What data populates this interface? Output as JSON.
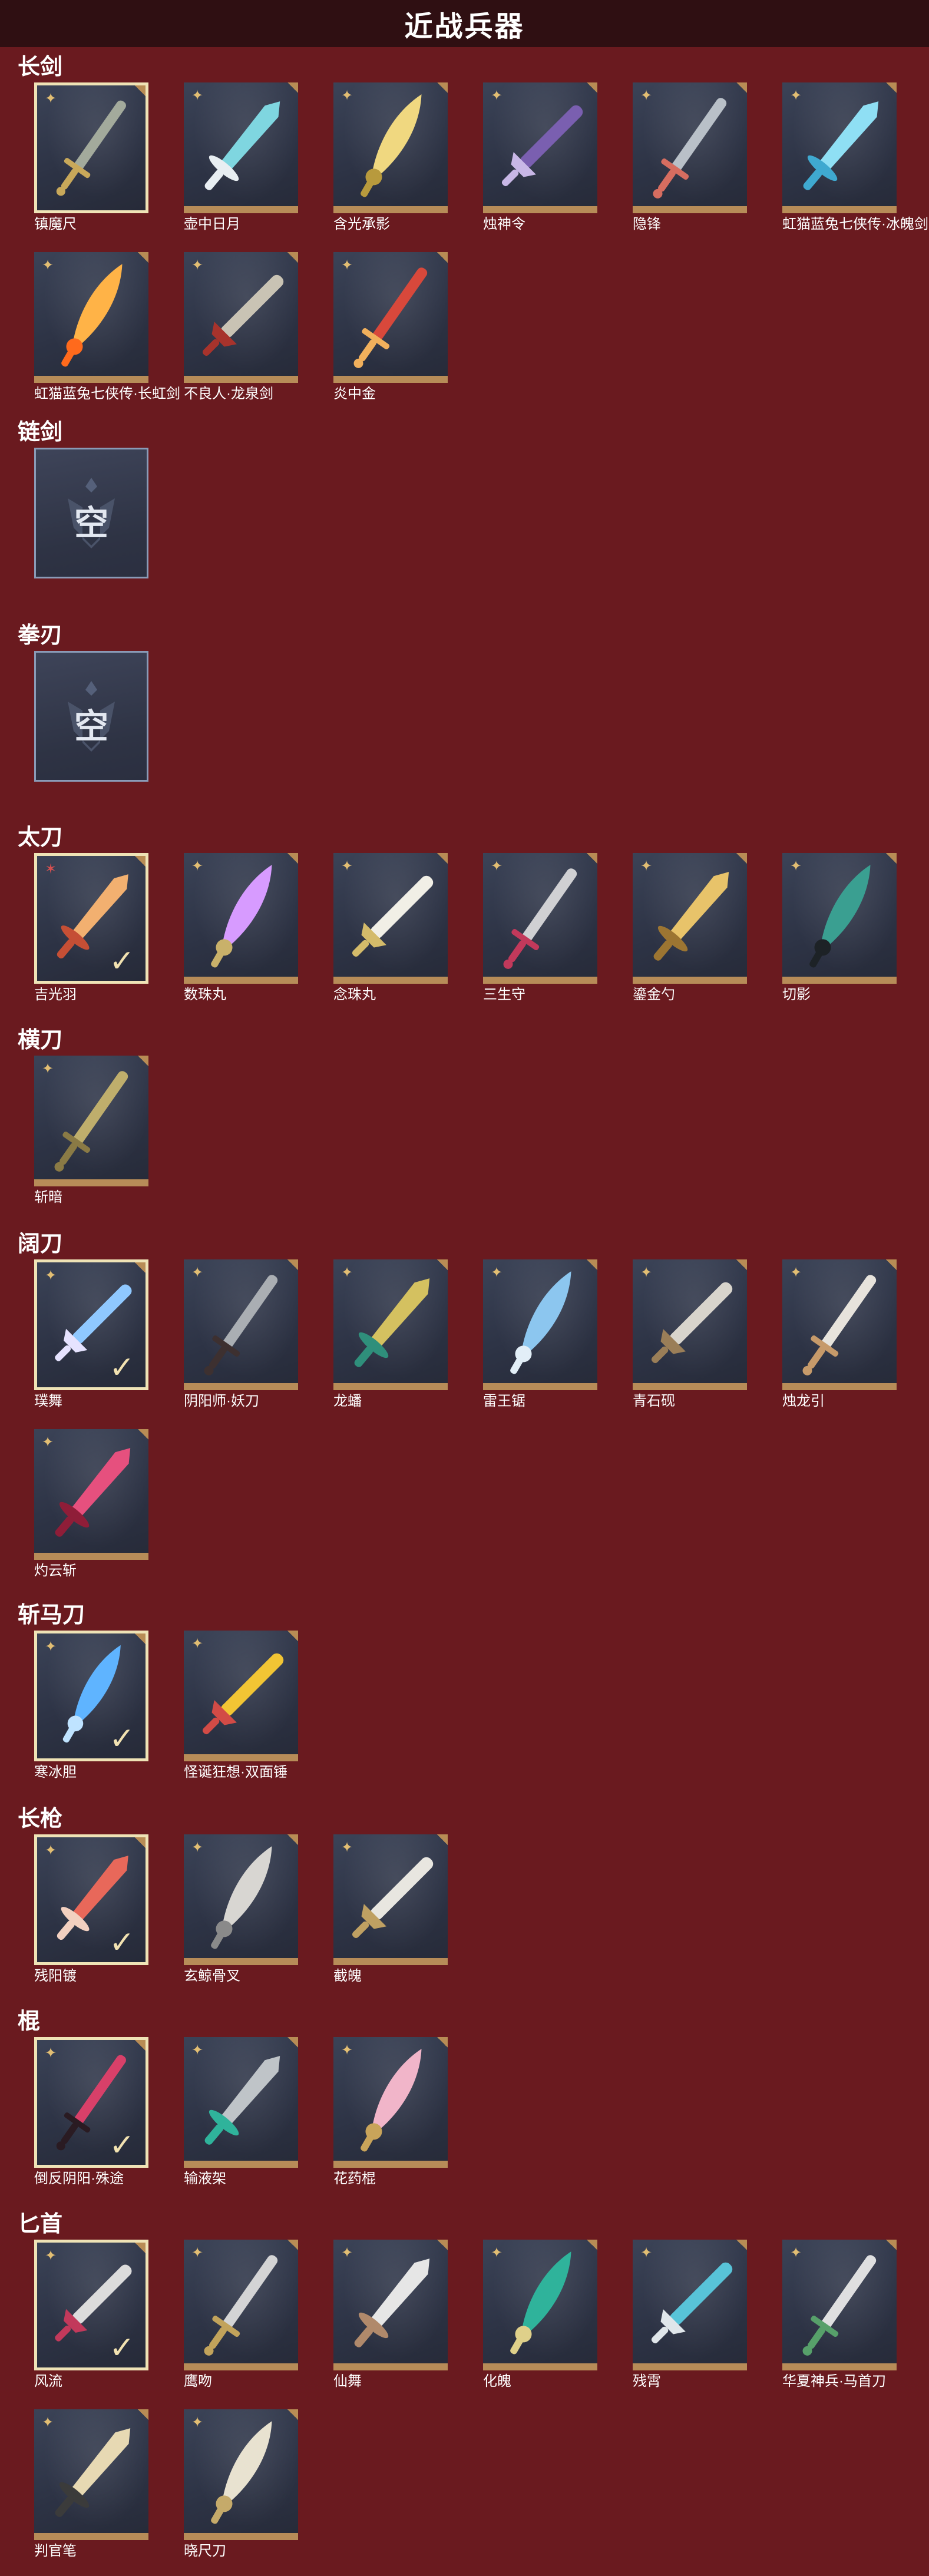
{
  "header": {
    "title": "近战兵器"
  },
  "sections": [
    {
      "label": "长剑",
      "items": [
        {
          "name": "镇魔尺",
          "colors": [
            "#a9b0a0",
            "#c8a85a"
          ],
          "badge": "gold",
          "selected": true
        },
        {
          "name": "壶中日月",
          "colors": [
            "#7fd6e0",
            "#e8eef2"
          ],
          "badge": "gold"
        },
        {
          "name": "含光承影",
          "colors": [
            "#f0d880",
            "#b89a3d"
          ],
          "badge": "gold"
        },
        {
          "name": "烛神令",
          "colors": [
            "#7a5fb0",
            "#c8b7e6"
          ],
          "badge": "gold"
        },
        {
          "name": "隐锋",
          "colors": [
            "#c0c7cf",
            "#d66d60"
          ],
          "badge": "gold"
        },
        {
          "name": "虹猫蓝兔七侠传·冰魄剑",
          "colors": [
            "#8fdff4",
            "#3fa9d0"
          ],
          "badge": "gold"
        },
        {
          "name": "虹猫蓝兔七侠传·长虹剑",
          "colors": [
            "#ffb347",
            "#ff6a1c"
          ],
          "badge": "gold"
        },
        {
          "name": "不良人·龙泉剑",
          "colors": [
            "#c9c3b4",
            "#a7332c"
          ],
          "badge": "gold"
        },
        {
          "name": "炎中金",
          "colors": [
            "#e0493a",
            "#f1b05c"
          ],
          "badge": "gold"
        }
      ]
    },
    {
      "label": "链剑",
      "empty": true,
      "empty_text": "空"
    },
    {
      "label": "拳刃",
      "empty": true,
      "empty_text": "空"
    },
    {
      "label": "太刀",
      "items": [
        {
          "name": "吉光羽",
          "colors": [
            "#f2b070",
            "#c54f35"
          ],
          "badge": "red",
          "selected": true,
          "checked": true
        },
        {
          "name": "数珠丸",
          "colors": [
            "#d79bff",
            "#c9b16a"
          ],
          "badge": "gold"
        },
        {
          "name": "念珠丸",
          "colors": [
            "#f1efe6",
            "#d4bb6a"
          ],
          "badge": "gold"
        },
        {
          "name": "三生守",
          "colors": [
            "#d8d8da",
            "#c2395b"
          ],
          "badge": "gold"
        },
        {
          "name": "鎏金勺",
          "colors": [
            "#e8c36a",
            "#9c7532"
          ],
          "badge": "gold"
        },
        {
          "name": "切影",
          "colors": [
            "#3a9f91",
            "#1d2226"
          ],
          "badge": "gold"
        }
      ]
    },
    {
      "label": "横刀",
      "items": [
        {
          "name": "斩暗",
          "colors": [
            "#c6b46e",
            "#8a7a45"
          ],
          "badge": "gold"
        }
      ]
    },
    {
      "label": "阔刀",
      "items": [
        {
          "name": "璞舞",
          "colors": [
            "#8fc8ff",
            "#e6e3ff"
          ],
          "badge": "gold",
          "selected": true,
          "checked": true
        },
        {
          "name": "阴阳师·妖刀",
          "colors": [
            "#b0b4b8",
            "#3d3030"
          ],
          "badge": "gold"
        },
        {
          "name": "龙蟠",
          "colors": [
            "#d4c160",
            "#2f8f7b"
          ],
          "badge": "gold"
        },
        {
          "name": "雷王锯",
          "colors": [
            "#8cc6ef",
            "#e2eef7"
          ],
          "badge": "gold"
        },
        {
          "name": "青石砚",
          "colors": [
            "#d8d4cc",
            "#9a7e58"
          ],
          "badge": "gold"
        },
        {
          "name": "烛龙引",
          "colors": [
            "#f0ece4",
            "#c69a6a"
          ],
          "badge": "gold"
        },
        {
          "name": "灼云斩",
          "colors": [
            "#e6507e",
            "#8f1d38"
          ],
          "badge": "gold"
        }
      ]
    },
    {
      "label": "斩马刀",
      "items": [
        {
          "name": "寒冰胆",
          "colors": [
            "#5fb4ff",
            "#bfe3ff"
          ],
          "badge": "gold",
          "selected": true,
          "checked": true
        },
        {
          "name": "怪诞狂想·双面锤",
          "colors": [
            "#f2c534",
            "#d24b46"
          ],
          "badge": "gold"
        }
      ]
    },
    {
      "label": "长枪",
      "items": [
        {
          "name": "残阳镀",
          "colors": [
            "#e8685a",
            "#f2d0c0"
          ],
          "badge": "gold",
          "selected": true,
          "checked": true
        },
        {
          "name": "玄鲸骨叉",
          "colors": [
            "#d8d6d2",
            "#8a8a8a"
          ],
          "badge": "gold"
        },
        {
          "name": "截魄",
          "colors": [
            "#e8e6e0",
            "#bfa062"
          ],
          "badge": "gold"
        }
      ]
    },
    {
      "label": "棍",
      "items": [
        {
          "name": "倒反阴阳·殊途",
          "colors": [
            "#e0406a",
            "#2a1b22"
          ],
          "badge": "gold",
          "selected": true,
          "checked": true
        },
        {
          "name": "输液架",
          "colors": [
            "#bfc4c8",
            "#2fb39b"
          ],
          "badge": "gold"
        },
        {
          "name": "花药棍",
          "colors": [
            "#f1b5c9",
            "#c9a45a"
          ],
          "badge": "gold"
        }
      ]
    },
    {
      "label": "匕首",
      "items": [
        {
          "name": "风流",
          "colors": [
            "#dcdcdc",
            "#c2395b"
          ],
          "badge": "gold",
          "selected": true,
          "checked": true
        },
        {
          "name": "鹰吻",
          "colors": [
            "#dcdcdc",
            "#c2a35b"
          ],
          "badge": "gold"
        },
        {
          "name": "仙舞",
          "colors": [
            "#e6e6e6",
            "#b0896b"
          ],
          "badge": "gold"
        },
        {
          "name": "化魄",
          "colors": [
            "#2fb39b",
            "#dfd08a"
          ],
          "badge": "gold"
        },
        {
          "name": "残霄",
          "colors": [
            "#58c3d8",
            "#e0e6ea"
          ],
          "badge": "gold"
        },
        {
          "name": "华夏神兵·马首刀",
          "colors": [
            "#e8e8e8",
            "#57a06a"
          ],
          "badge": "gold"
        },
        {
          "name": "判官笔",
          "colors": [
            "#e7d9b3",
            "#3b3b3b"
          ],
          "badge": "gold"
        },
        {
          "name": "晓尺刀",
          "colors": [
            "#e8e2d0",
            "#c5aa6a"
          ],
          "badge": "gold"
        }
      ]
    }
  ]
}
